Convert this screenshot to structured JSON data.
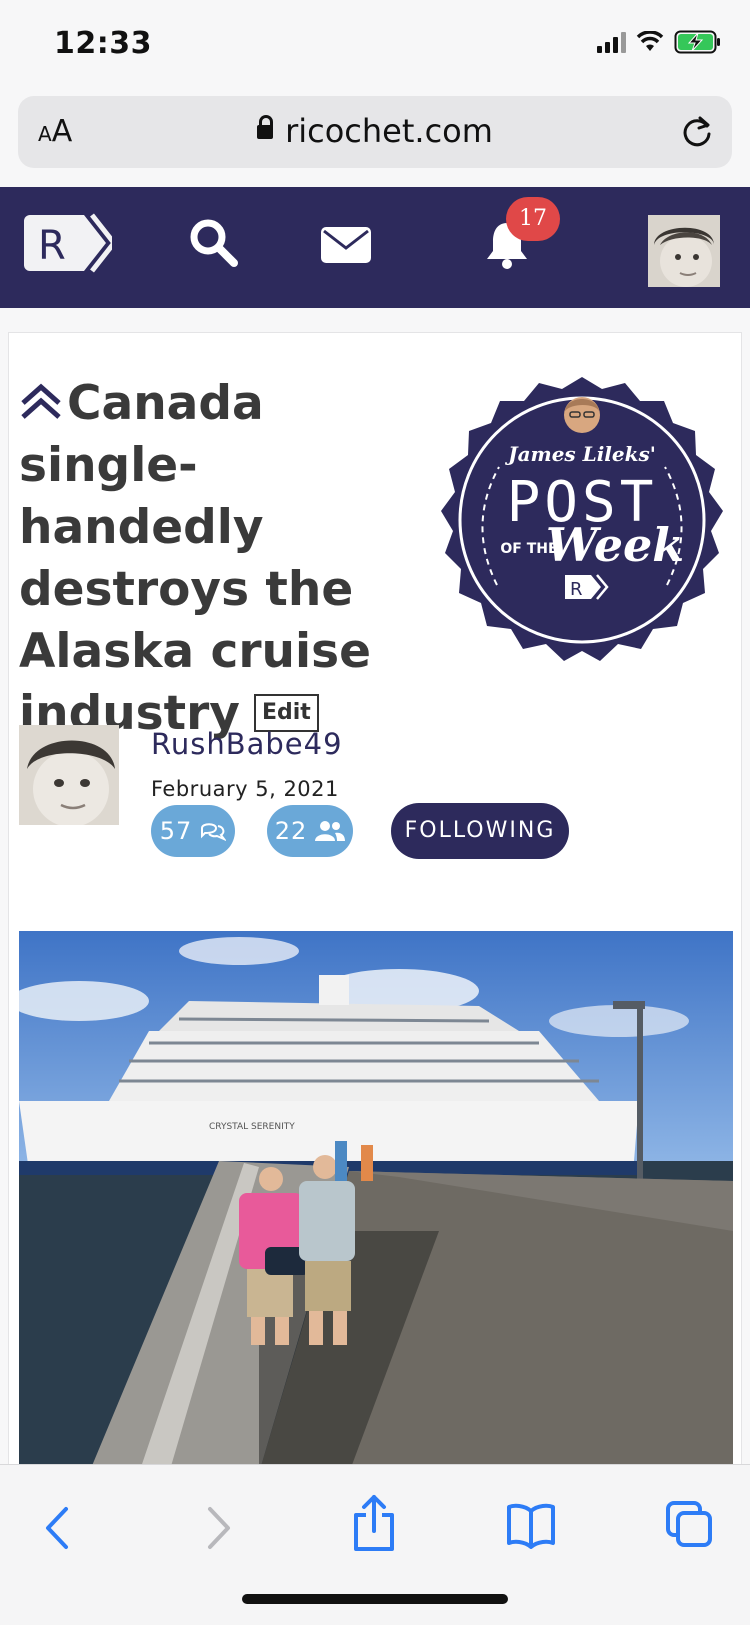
{
  "status": {
    "time": "12:33"
  },
  "browser": {
    "text_size_label_small": "A",
    "text_size_label_large": "A",
    "domain": "ricochet.com"
  },
  "header": {
    "logo_letter": "R",
    "notification_count": "17",
    "colors": {
      "navy": "#2d2a5c",
      "badge_red": "#e04848"
    }
  },
  "post": {
    "title": "Canada single-handedly destroys the Alaska cruise industry",
    "edit_label": "Edit",
    "badge": {
      "line1": "James Lileks'",
      "line2": "POST",
      "line3": "OF THE",
      "line4": "Week",
      "logo_letter": "R"
    },
    "author": "RushBabe49",
    "date": "February 5, 2021",
    "comment_count": "57",
    "member_count": "22",
    "follow_label": "FOLLOWING",
    "photo_ship_name": "CRYSTAL SERENITY",
    "colors": {
      "pill_blue": "#6aa8d8"
    }
  },
  "toolbar": {
    "icons": [
      "back-icon",
      "forward-icon",
      "share-icon",
      "bookmarks-icon",
      "tabs-icon"
    ]
  }
}
